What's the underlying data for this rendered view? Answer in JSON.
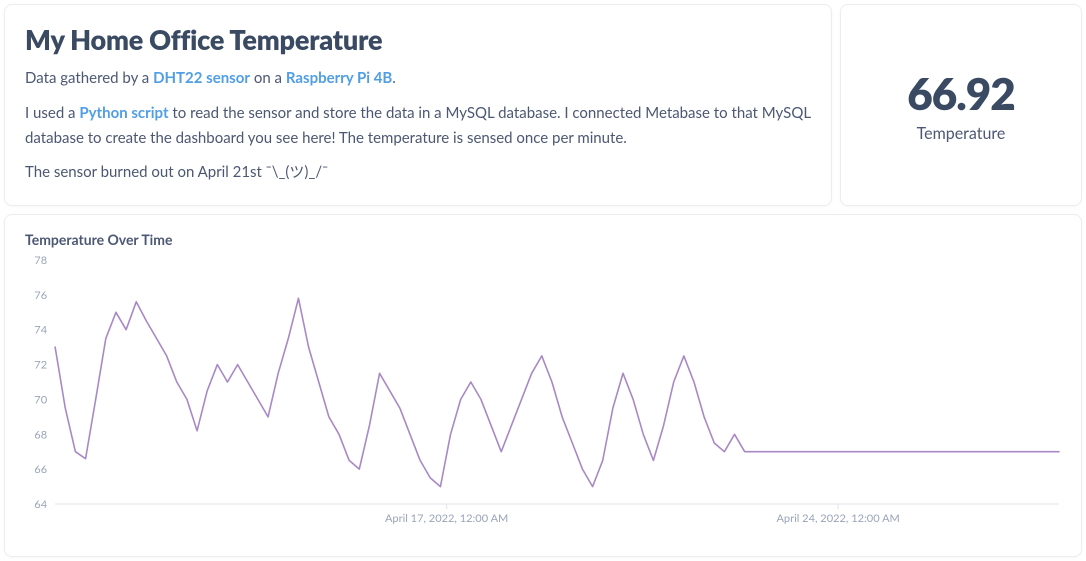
{
  "header": {
    "title": "My Home Office Temperature",
    "p1_pre": "Data gathered by a ",
    "link_sensor": "DHT22 sensor",
    "p1_mid": " on a ",
    "link_board": "Raspberry Pi 4B",
    "p1_post": ".",
    "p2_pre": "I used a ",
    "link_script": "Python script",
    "p2_post": " to read the sensor and store the data in a MySQL database. I connected Metabase to that MySQL database to create the dashboard you see here! The temperature is sensed once per minute.",
    "p3": "The sensor burned out on April 21st ¯\\_(ツ)_/¯"
  },
  "kpi": {
    "value": "66.92",
    "label": "Temperature"
  },
  "chart_data": {
    "type": "line",
    "title": "Temperature Over Time",
    "xlabel": "",
    "ylabel": "",
    "ylim": [
      64,
      78
    ],
    "y_ticks": [
      64,
      66,
      68,
      70,
      72,
      74,
      76,
      78
    ],
    "x_range_days": [
      "2022-04-10",
      "2022-04-28"
    ],
    "x_tick_labels": [
      {
        "pos": 0.39,
        "label": "April 17, 2022, 12:00 AM"
      },
      {
        "pos": 0.78,
        "label": "April 24, 2022, 12:00 AM"
      }
    ],
    "series": [
      {
        "name": "Temperature",
        "color": "#a989c5",
        "values": [
          73.0,
          69.5,
          67.0,
          66.6,
          70.0,
          73.5,
          75.0,
          74.0,
          75.6,
          74.5,
          73.5,
          72.5,
          71.0,
          70.0,
          68.2,
          70.5,
          72.0,
          71.0,
          72.0,
          71.0,
          70.0,
          69.0,
          71.5,
          73.5,
          75.8,
          73.0,
          71.0,
          69.0,
          68.0,
          66.5,
          66.0,
          68.5,
          71.5,
          70.5,
          69.5,
          68.0,
          66.5,
          65.5,
          65.0,
          68.0,
          70.0,
          71.0,
          70.0,
          68.5,
          67.0,
          68.5,
          70.0,
          71.5,
          72.5,
          71.0,
          69.0,
          67.5,
          66.0,
          65.0,
          66.5,
          69.5,
          71.5,
          70.0,
          68.0,
          66.5,
          68.5,
          71.0,
          72.5,
          71.0,
          69.0,
          67.5,
          67.0,
          68.0,
          67.0,
          67.0,
          67.0,
          67.0,
          67.0,
          67.0,
          67.0,
          67.0,
          67.0,
          67.0,
          67.0,
          67.0,
          67.0,
          67.0,
          67.0,
          67.0,
          67.0,
          67.0,
          67.0,
          67.0,
          67.0,
          67.0,
          67.0,
          67.0,
          67.0,
          67.0,
          67.0,
          67.0,
          67.0,
          67.0,
          67.0,
          67.0
        ]
      }
    ]
  }
}
